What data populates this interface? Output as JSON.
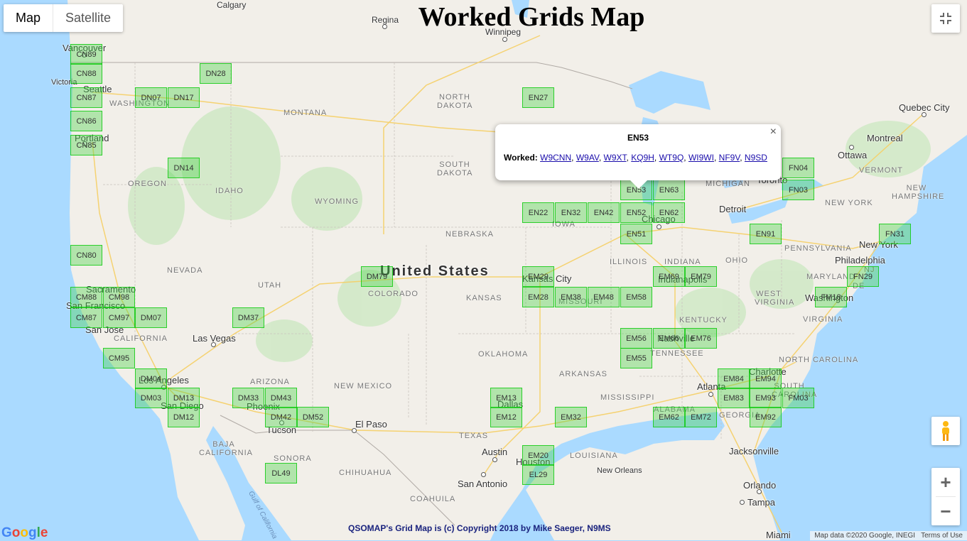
{
  "title": "Worked Grids Map",
  "map_type": {
    "map": "Map",
    "satellite": "Satellite"
  },
  "popup": {
    "grid": "EN53",
    "worked_label": "Worked:",
    "calls": [
      "W9CNN",
      "W9AV",
      "W9XT",
      "KQ9H",
      "WT9Q",
      "WI9WI",
      "NF9V",
      "N9SD"
    ],
    "close": "×"
  },
  "footer": "QSOMAP's Grid Map is (c) Copyright 2018 by Mike Saeger, N9MS",
  "attribution": {
    "data": "Map data ©2020 Google, INEGI",
    "terms": "Terms of Use"
  },
  "google_logo": "Google",
  "icons": {
    "fullscreen": "fullscreen-exit-icon",
    "pegman": "pegman-icon",
    "zoom_in": "+",
    "zoom_out": "−"
  },
  "colors": {
    "grid_fill": "#46d246",
    "grid_border": "#00c800",
    "land": "#f2efe9",
    "water": "#aadaff",
    "parks": "#cde8c3"
  },
  "country": "United States",
  "grids": [
    {
      "id": "CN88"
    },
    {
      "id": "CN87"
    },
    {
      "id": "CN86"
    },
    {
      "id": "CN85"
    },
    {
      "id": "CN80"
    },
    {
      "id": "CN89"
    },
    {
      "id": "DN07"
    },
    {
      "id": "DN17"
    },
    {
      "id": "DN28"
    },
    {
      "id": "DN14"
    },
    {
      "id": "EN27"
    },
    {
      "id": "EN53"
    },
    {
      "id": "EN63"
    },
    {
      "id": "EN22"
    },
    {
      "id": "EN32"
    },
    {
      "id": "EN42"
    },
    {
      "id": "EN52"
    },
    {
      "id": "EN62"
    },
    {
      "id": "EN51"
    },
    {
      "id": "FN04"
    },
    {
      "id": "FN03"
    },
    {
      "id": "EN91"
    },
    {
      "id": "FN31"
    },
    {
      "id": "FN29"
    },
    {
      "id": "FM18"
    },
    {
      "id": "EM69"
    },
    {
      "id": "EM79"
    },
    {
      "id": "EM29"
    },
    {
      "id": "EM28"
    },
    {
      "id": "EM38"
    },
    {
      "id": "EM48"
    },
    {
      "id": "EM58"
    },
    {
      "id": "DM79"
    },
    {
      "id": "CM88"
    },
    {
      "id": "CM98"
    },
    {
      "id": "CM87"
    },
    {
      "id": "CM97"
    },
    {
      "id": "DM07"
    },
    {
      "id": "DM37"
    },
    {
      "id": "CM95"
    },
    {
      "id": "DM04"
    },
    {
      "id": "DM03"
    },
    {
      "id": "DM13"
    },
    {
      "id": "DM12"
    },
    {
      "id": "DM33"
    },
    {
      "id": "DM43"
    },
    {
      "id": "DM42"
    },
    {
      "id": "DM52"
    },
    {
      "id": "EM56"
    },
    {
      "id": "EM66"
    },
    {
      "id": "EM76"
    },
    {
      "id": "EM55"
    },
    {
      "id": "EM13"
    },
    {
      "id": "EM12"
    },
    {
      "id": "EM32"
    },
    {
      "id": "EM84"
    },
    {
      "id": "EM94"
    },
    {
      "id": "EM83"
    },
    {
      "id": "EM93"
    },
    {
      "id": "FM03"
    },
    {
      "id": "EM62"
    },
    {
      "id": "EM72"
    },
    {
      "id": "EM92"
    },
    {
      "id": "EM20"
    },
    {
      "id": "EL29"
    },
    {
      "id": "DL49"
    }
  ],
  "places": {
    "cities": [
      "Calgary",
      "Regina",
      "Winnipeg",
      "Vancouver",
      "Victoria",
      "Seattle",
      "Portland",
      "Sacramento",
      "San Francisco",
      "San Jose",
      "Los Angeles",
      "San Diego",
      "Las Vegas",
      "Phoenix",
      "Tucson",
      "El Paso",
      "Dallas",
      "Austin",
      "Houston",
      "San Antonio",
      "New Orleans",
      "Kansas City",
      "Chicago",
      "Indianapolis",
      "Nashville",
      "Atlanta",
      "Charlotte",
      "Detroit",
      "Toronto",
      "Ottawa",
      "Montreal",
      "Quebec City",
      "New York",
      "Philadelphia",
      "Washington",
      "Jacksonville",
      "Orlando",
      "Tampa",
      "Miami"
    ],
    "states": [
      "WASHINGTON",
      "MONTANA",
      "NORTH DAKOTA",
      "SOUTH DAKOTA",
      "OREGON",
      "IDAHO",
      "WYOMING",
      "NEBRASKA",
      "NEVADA",
      "UTAH",
      "COLORADO",
      "KANSAS",
      "CALIFORNIA",
      "ARIZONA",
      "NEW MEXICO",
      "OKLAHOMA",
      "TEXAS",
      "ARKANSAS",
      "MISSOURI",
      "IOWA",
      "ILLINOIS",
      "INDIANA",
      "OHIO",
      "KENTUCKY",
      "TENNESSEE",
      "MISSISSIPPI",
      "ALABAMA",
      "GEORGIA",
      "LOUISIANA",
      "SOUTH CAROLINA",
      "NORTH CAROLINA",
      "VIRGINIA",
      "WEST VIRGINIA",
      "PENNSYLVANIA",
      "NEW YORK",
      "MARYLAND",
      "VERMONT",
      "NEW HAMPSHIRE",
      "MICHIGAN",
      "BAJA CALIFORNIA",
      "SONORA",
      "CHIHUAHUA",
      "COAHUILA",
      "NJ",
      "DE"
    ],
    "water": [
      "Gulf of California"
    ]
  }
}
